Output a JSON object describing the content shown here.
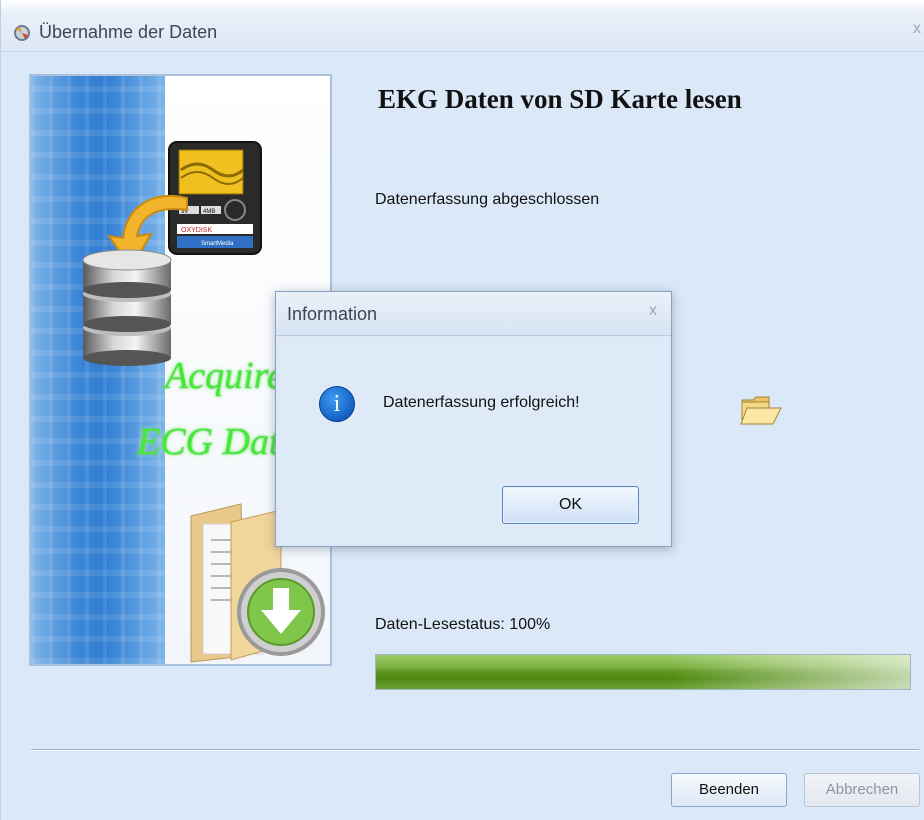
{
  "window": {
    "title": "Übernahme der Daten",
    "close_glyph": "x"
  },
  "banner": {
    "line1": "Acquire",
    "line2": "ECG Data",
    "sd_card_brand": "OXYDISK",
    "sd_card_type": "SmartMedia",
    "sd_card_spec1": "3V",
    "sd_card_spec2": "4MB"
  },
  "main": {
    "heading": "EKG Daten von SD Karte lesen",
    "status": "Datenerfassung abgeschlossen",
    "progress_label": "Daten-Lesestatus: 100%",
    "progress_fraction": 1.0,
    "folder_icon": "open-folder-icon"
  },
  "footer": {
    "end_label": "Beenden",
    "cancel_label": "Abbrechen"
  },
  "dialog": {
    "title": "Information",
    "close_glyph": "x",
    "icon": "info-icon",
    "icon_glyph": "i",
    "message": "Datenerfassung erfolgreich!",
    "ok_label": "OK"
  },
  "colors": {
    "progress": "#5c951d",
    "banner_text": "#46e83a",
    "info_icon": "#1560c4"
  }
}
